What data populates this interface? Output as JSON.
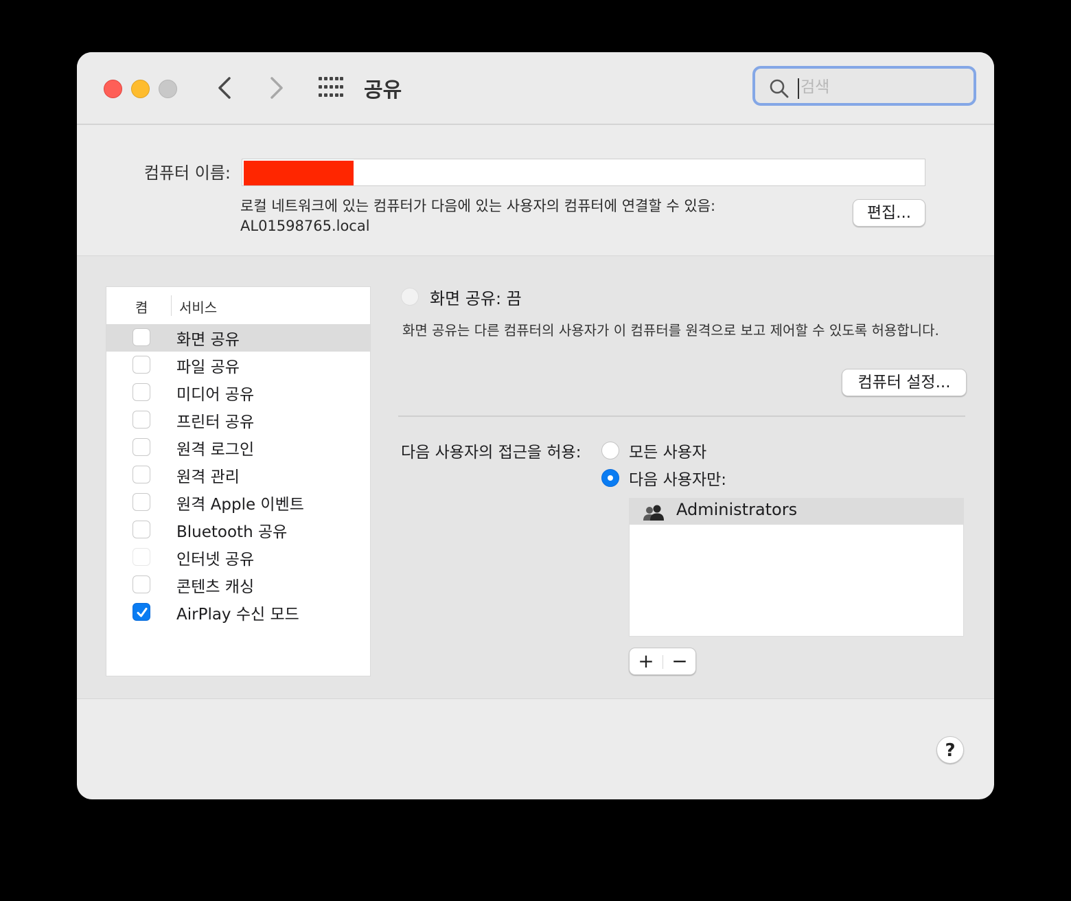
{
  "window": {
    "title": "공유",
    "search_placeholder": "검색"
  },
  "computer_name": {
    "label": "컴퓨터 이름:",
    "value": "",
    "info_line1": "로컬 네트워크에 있는 컴퓨터가 다음에 있는 사용자의 컴퓨터에 연결할 수 있음:",
    "info_line2": "AL01598765.local",
    "edit_button": "편집..."
  },
  "services": {
    "header_on": "켬",
    "header_service": "서비스",
    "items": [
      {
        "label": "화면 공유",
        "checked": false,
        "selected": true
      },
      {
        "label": "파일 공유",
        "checked": false
      },
      {
        "label": "미디어 공유",
        "checked": false
      },
      {
        "label": "프린터 공유",
        "checked": false
      },
      {
        "label": "원격 로그인",
        "checked": false
      },
      {
        "label": "원격 관리",
        "checked": false
      },
      {
        "label": "원격 Apple 이벤트",
        "checked": false
      },
      {
        "label": "Bluetooth 공유",
        "checked": false
      },
      {
        "label": "인터넷 공유",
        "checked": false,
        "disabled": true
      },
      {
        "label": "콘텐츠 캐싱",
        "checked": false
      },
      {
        "label": "AirPlay 수신 모드",
        "checked": true
      }
    ]
  },
  "detail": {
    "status_title": "화면 공유: 끔",
    "description": "화면 공유는 다른 컴퓨터의 사용자가 이 컴퓨터를 원격으로 보고 제어할 수 있도록 허용합니다.",
    "settings_button": "컴퓨터 설정...",
    "access_label": "다음 사용자의 접근을 허용:",
    "option_all": "모든 사용자",
    "option_only": "다음 사용자만:",
    "selected_option": "only",
    "users": [
      {
        "name": "Administrators"
      }
    ],
    "add_button": "+",
    "remove_button": "−"
  },
  "help_button": "?",
  "colors": {
    "accent": "#0a7cf2",
    "redaction": "#ff2600",
    "close": "#fe5f57",
    "minimize": "#febc2e"
  },
  "icons": [
    "back-chevron-icon",
    "forward-chevron-icon",
    "grid-icon",
    "search-icon",
    "group-icon",
    "checkmark-icon"
  ]
}
